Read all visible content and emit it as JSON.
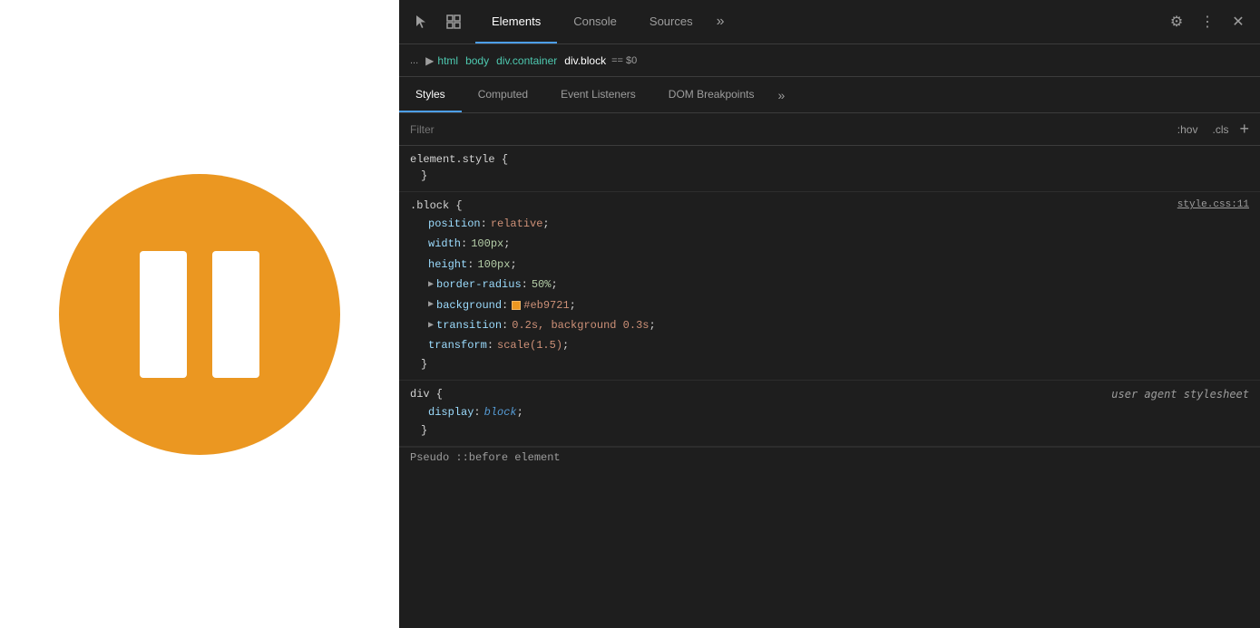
{
  "leftPanel": {
    "circleColor": "#eb9721"
  },
  "devtools": {
    "toolbar": {
      "tabs": [
        {
          "label": "Elements",
          "active": true
        },
        {
          "label": "Console",
          "active": false
        },
        {
          "label": "Sources",
          "active": false
        }
      ],
      "more_label": "»",
      "gear_icon": "⚙",
      "dots_icon": "⋮",
      "close_icon": "✕",
      "cursor_icon": "↖",
      "box_icon": "▣"
    },
    "breadcrumb": {
      "dots": "...",
      "items": [
        "html",
        "body",
        "div.container"
      ],
      "active": "div.block",
      "comment": "== $0"
    },
    "stylesTabs": {
      "tabs": [
        {
          "label": "Styles",
          "active": true
        },
        {
          "label": "Computed",
          "active": false
        },
        {
          "label": "Event Listeners",
          "active": false
        },
        {
          "label": "DOM Breakpoints",
          "active": false
        }
      ],
      "more_label": "»"
    },
    "filterBar": {
      "placeholder": "Filter",
      "hov_label": ":hov",
      "cls_label": ".cls",
      "plus_label": "+"
    },
    "rules": [
      {
        "id": "element-style",
        "selector": "element.style {",
        "close": "}",
        "source": "",
        "properties": []
      },
      {
        "id": "block-rule",
        "selector": ".block {",
        "close": "}",
        "source": "style.css:11",
        "properties": [
          {
            "name": "position",
            "colon": ":",
            "value": "relative",
            "semicolon": ";",
            "type": "keyword",
            "hasExpand": false
          },
          {
            "name": "width",
            "colon": ":",
            "value": "100px",
            "semicolon": ";",
            "type": "number",
            "hasExpand": false
          },
          {
            "name": "height",
            "colon": ":",
            "value": "100px",
            "semicolon": ";",
            "type": "number",
            "hasExpand": false
          },
          {
            "name": "border-radius",
            "colon": ":",
            "value": "50%",
            "semicolon": ";",
            "type": "number",
            "hasExpand": true
          },
          {
            "name": "background",
            "colon": ":",
            "value": "#eb9721",
            "semicolon": ";",
            "type": "color",
            "hasExpand": true,
            "color": "#eb9721"
          },
          {
            "name": "transition",
            "colon": ":",
            "value": "0.2s, background 0.3s",
            "semicolon": ";",
            "type": "keyword",
            "hasExpand": true
          },
          {
            "name": "transform",
            "colon": ":",
            "value": "scale(1.5)",
            "semicolon": ";",
            "type": "keyword",
            "hasExpand": false
          }
        ]
      },
      {
        "id": "div-rule",
        "selector": "div {",
        "close": "}",
        "source": "user agent stylesheet",
        "properties": [
          {
            "name": "display",
            "colon": ":",
            "value": "block",
            "semicolon": ";",
            "type": "keyword-italic",
            "hasExpand": false
          }
        ]
      }
    ],
    "pseudoElement": "Pseudo ::before element"
  }
}
